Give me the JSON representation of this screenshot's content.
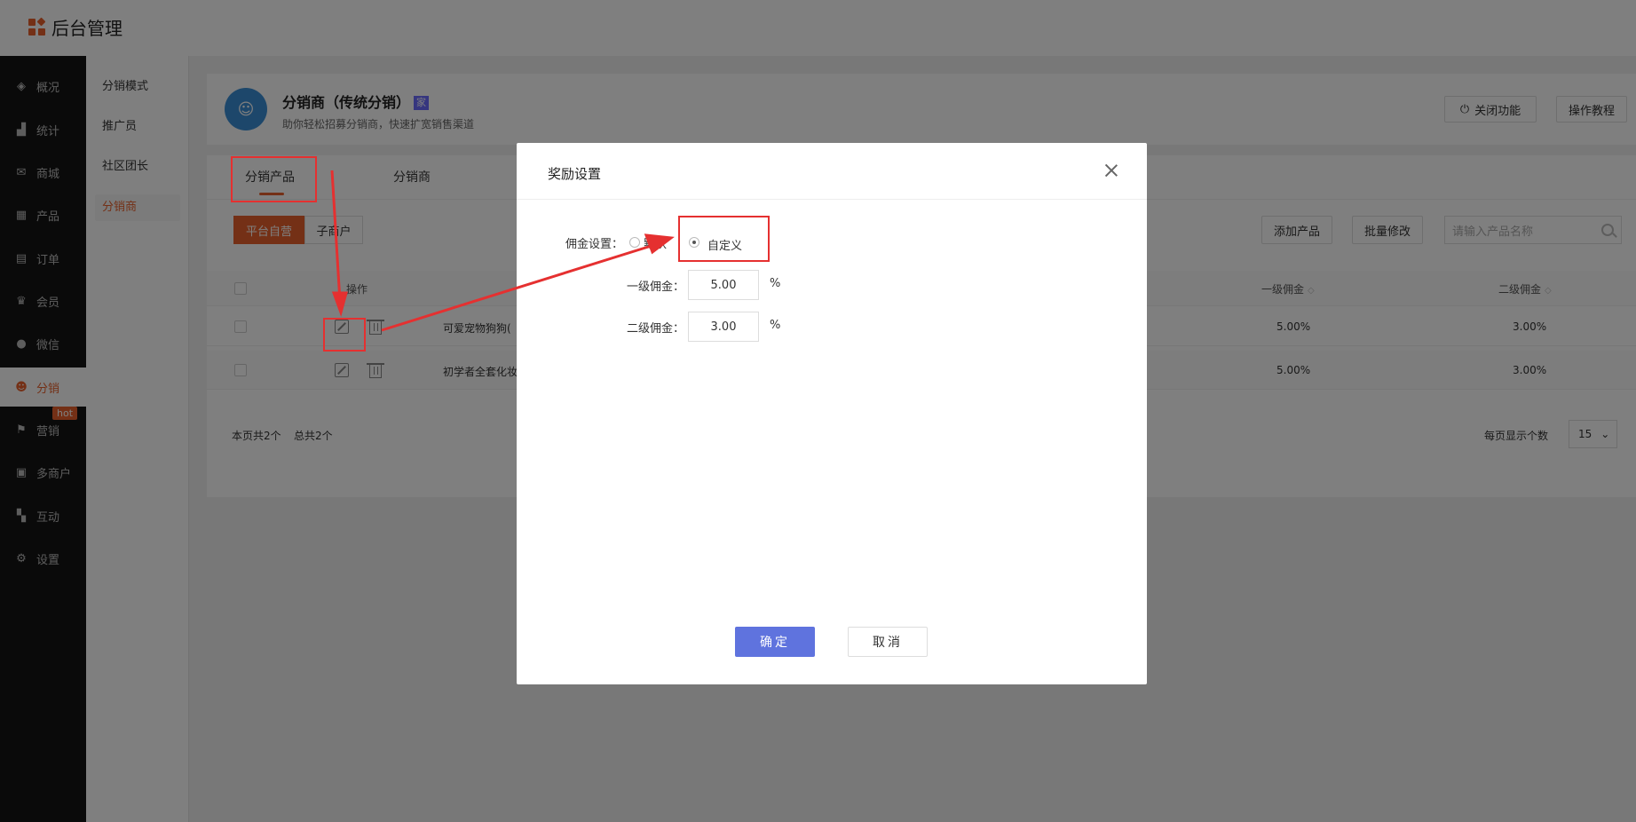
{
  "app": {
    "title": "后台管理"
  },
  "nav": {
    "items": [
      {
        "label": "概况",
        "icon": "layers-icon"
      },
      {
        "label": "统计",
        "icon": "chart-icon"
      },
      {
        "label": "商城",
        "icon": "mail-icon"
      },
      {
        "label": "产品",
        "icon": "grid-icon"
      },
      {
        "label": "订单",
        "icon": "clipboard-icon"
      },
      {
        "label": "会员",
        "icon": "crown-icon"
      },
      {
        "label": "微信",
        "icon": "wechat-icon"
      },
      {
        "label": "分销",
        "icon": "user-group-icon",
        "active": true
      },
      {
        "label": "营销",
        "icon": "flag-icon",
        "badge": "hot"
      },
      {
        "label": "多商户",
        "icon": "store-icon"
      },
      {
        "label": "互动",
        "icon": "apps-icon"
      },
      {
        "label": "设置",
        "icon": "gear-icon"
      }
    ]
  },
  "subnav": {
    "items": [
      {
        "label": "分销模式"
      },
      {
        "label": "推广员"
      },
      {
        "label": "社区团长"
      },
      {
        "label": "分销商",
        "active": true
      }
    ]
  },
  "header": {
    "title": "分销商（传统分销）",
    "badge": "家",
    "subtitle": "助你轻松招募分销商，快速扩宽销售渠道",
    "close_feature": "关闭功能",
    "tutorial": "操作教程"
  },
  "tabs": [
    {
      "label": "分销产品",
      "active": true
    },
    {
      "label": "分销商"
    }
  ],
  "toolbar": {
    "seg_platform": "平台自营",
    "seg_merchant": "子商户",
    "add_product": "添加产品",
    "batch_edit": "批量修改",
    "search_placeholder": "请输入产品名称"
  },
  "table": {
    "headers": {
      "action": "操作",
      "level1": "一级佣金",
      "level2": "二级佣金"
    },
    "rows": [
      {
        "name": "可爱宠物狗狗(",
        "level1": "5.00%",
        "level2": "3.00%"
      },
      {
        "name": "初学者全套化妆",
        "level1": "5.00%",
        "level2": "3.00%"
      }
    ]
  },
  "pager": {
    "page_count": "本页共2个",
    "total": "总共2个",
    "per_page_label": "每页显示个数",
    "per_page_value": "15"
  },
  "dialog": {
    "title": "奖励设置",
    "commission_label": "佣金设置：",
    "option_default": "默认",
    "option_custom": "自定义",
    "level1_label": "一级佣金：",
    "level1_value": "5.00",
    "level2_label": "二级佣金：",
    "level2_value": "3.00",
    "unit": "%",
    "ok": "确定",
    "cancel": "取消"
  },
  "colors": {
    "accent": "#e8612c",
    "primary": "#5f73de",
    "annotation": "#e53030"
  }
}
